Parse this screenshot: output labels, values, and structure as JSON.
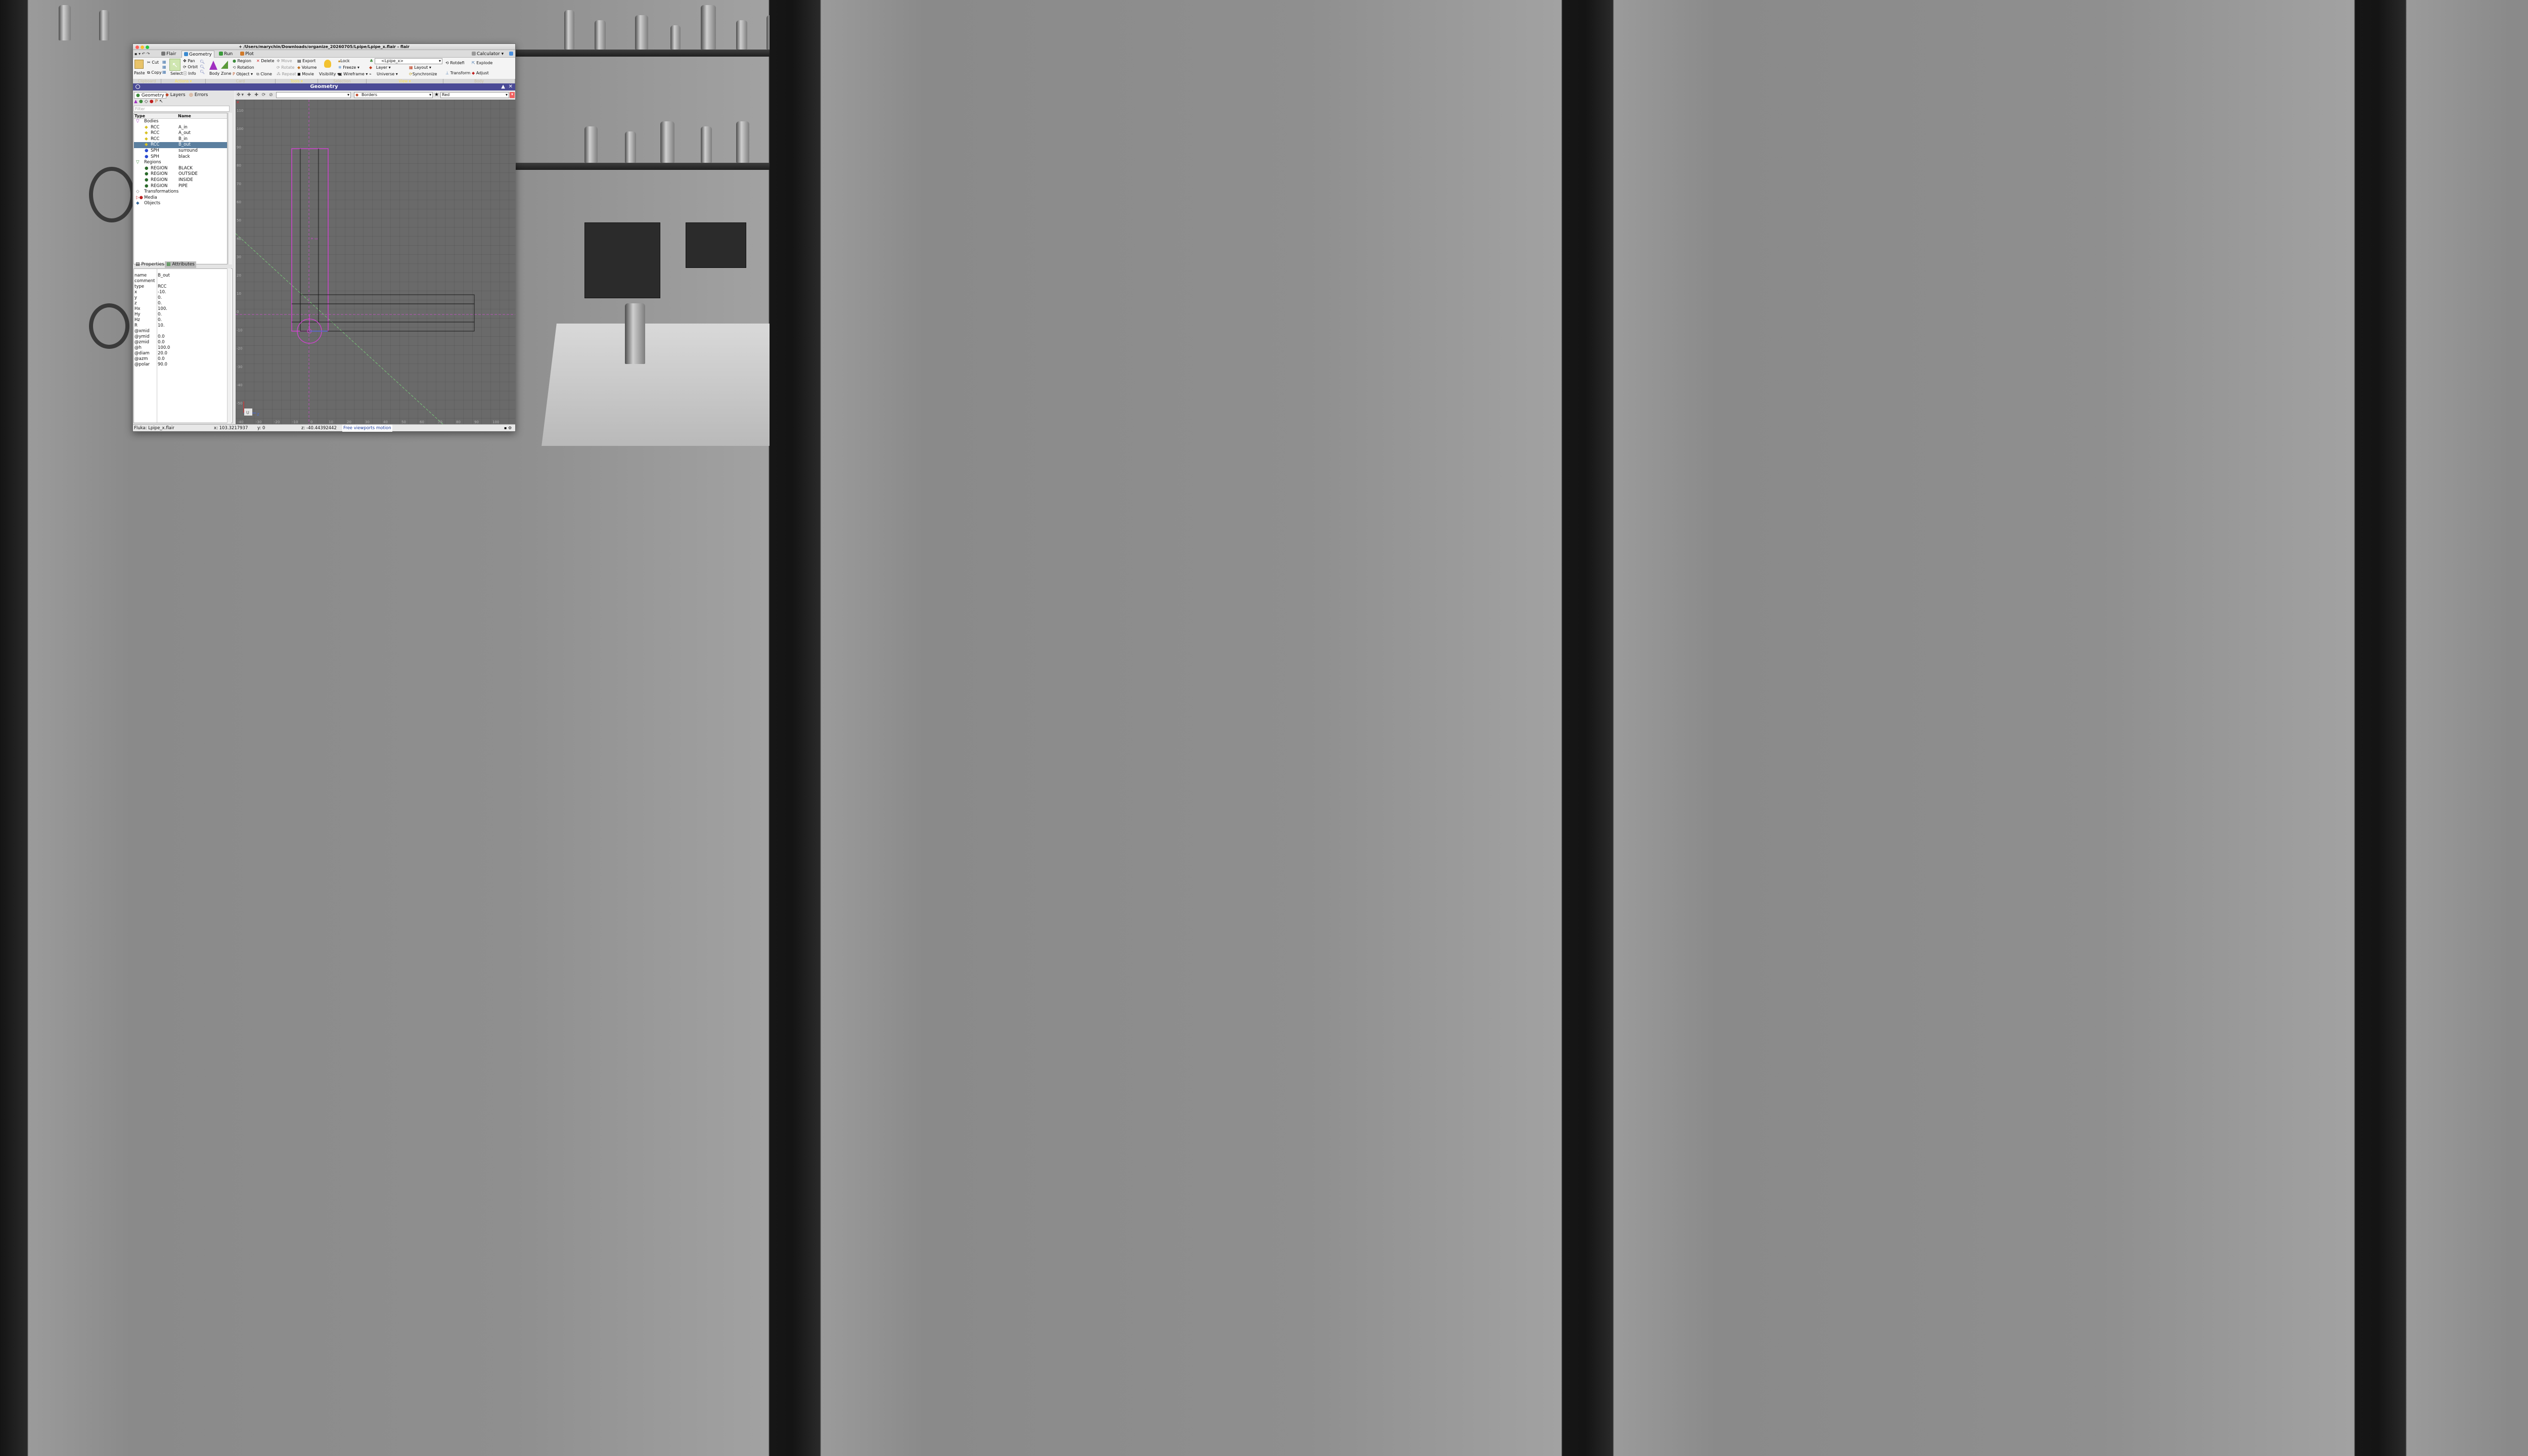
{
  "window": {
    "title": "+ /Users/marychin/Downloads/organize_20260705/Lpipe/Lpipe_x.flair - flair"
  },
  "tabs": [
    {
      "label": "Flair"
    },
    {
      "label": "Geometry"
    },
    {
      "label": "Run"
    },
    {
      "label": "Plot"
    }
  ],
  "calculator_label": "Calculator",
  "ribbon": {
    "clipboard": {
      "paste": "Paste",
      "cut": "Cut",
      "copy": "Copy",
      "group": "Clipboard"
    },
    "actions": {
      "select": "Select",
      "pan": "Pan",
      "orbit": "Orbit",
      "info": "Info",
      "group": "Actions"
    },
    "card": {
      "body": "Body",
      "zone": "Zone",
      "region": "Region",
      "rotation": "Rotation",
      "object": "Object",
      "delete": "Delete",
      "clone": "Clone",
      "group": "Card"
    },
    "tools": {
      "move": "Move",
      "rotate": "Rotate",
      "repeat": "Repeat",
      "export": "Export",
      "volume": "Volume",
      "movie": "Movie",
      "group": "Tools"
    },
    "selection": {
      "visibility": "Visibility",
      "lock": "Lock",
      "freeze": "Freeze",
      "wireframe": "Wireframe",
      "group": "Selection"
    },
    "view": {
      "combo": "<Lpipe_x>",
      "layer": "Layer",
      "universe": "Universe",
      "layout": "Layout",
      "synchronize": "Synchronize",
      "group": "View"
    },
    "body": {
      "rotdefi": "Rotdefi",
      "explode": "Explode",
      "transform": "Transform",
      "adjust": "Adjust",
      "group": "Body"
    }
  },
  "panel_title": "Geometry",
  "left_tabs": [
    {
      "label": "Geometry"
    },
    {
      "label": "Layers"
    },
    {
      "label": "Errors"
    }
  ],
  "filter_placeholder": "Filter",
  "tree": {
    "headers": {
      "type": "Type",
      "name": "Name"
    },
    "rows": [
      {
        "type": "Bodies",
        "name": ""
      },
      {
        "type": "RCC",
        "name": "A_in"
      },
      {
        "type": "RCC",
        "name": "A_out"
      },
      {
        "type": "RCC",
        "name": "B_in"
      },
      {
        "type": "RCC",
        "name": "B_out"
      },
      {
        "type": "SPH",
        "name": "surround"
      },
      {
        "type": "SPH",
        "name": "black"
      },
      {
        "type": "Regions",
        "name": ""
      },
      {
        "type": "REGION",
        "name": "BLACK"
      },
      {
        "type": "REGION",
        "name": "OUTSIDE"
      },
      {
        "type": "REGION",
        "name": "INSIDE"
      },
      {
        "type": "REGION",
        "name": "PIPE"
      },
      {
        "type": "Transformations",
        "name": ""
      },
      {
        "type": "Media",
        "name": ""
      },
      {
        "type": "Objects",
        "name": ""
      }
    ],
    "selected_index": 4
  },
  "prop_tabs": [
    {
      "label": "Properties"
    },
    {
      "label": "Attributes"
    }
  ],
  "properties": [
    {
      "key": "name",
      "value": "B_out"
    },
    {
      "key": "comment",
      "value": ""
    },
    {
      "key": "type",
      "value": "RCC"
    },
    {
      "key": "x",
      "value": "-10."
    },
    {
      "key": "y",
      "value": "0."
    },
    {
      "key": "z",
      "value": "0."
    },
    {
      "key": "Hx",
      "value": "100."
    },
    {
      "key": "Hy",
      "value": "0."
    },
    {
      "key": "Hz",
      "value": "0."
    },
    {
      "key": "R",
      "value": "10."
    },
    {
      "key": "@xmid",
      "value": ""
    },
    {
      "key": "@ymid",
      "value": "0.0"
    },
    {
      "key": "@zmid",
      "value": "0.0"
    },
    {
      "key": "@h",
      "value": "100.0"
    },
    {
      "key": "@diam",
      "value": "20.0"
    },
    {
      "key": "@azm",
      "value": "0.0"
    },
    {
      "key": "@polar",
      "value": "90.0"
    }
  ],
  "viewport": {
    "borders_label": "Borders",
    "color_label": "Red",
    "y_ticks": [
      "110",
      "100",
      "90",
      "80",
      "70",
      "60",
      "50",
      "40",
      "30",
      "20",
      "10",
      "0",
      "-10",
      "-20",
      "-30",
      "-40",
      "-50"
    ],
    "x_ticks": [
      "-40",
      "-30",
      "-20",
      "-10",
      "0",
      "10",
      "20",
      "30",
      "40",
      "50",
      "60",
      "70",
      "80",
      "90",
      "100"
    ],
    "axis_u": "U",
    "axis_z": "Z"
  },
  "status": {
    "file": "Fluka: Lpipe_x.flair",
    "x": "x: 103.3217937",
    "y": "y: 0",
    "z": "z: -40.44392442",
    "mode": "Free viewports motion"
  },
  "colors": {
    "panel_title_bg": "#4b4b96",
    "selection": "#5b7f9f",
    "magenta": "#e040e0",
    "green_line": "#7ad07a"
  }
}
